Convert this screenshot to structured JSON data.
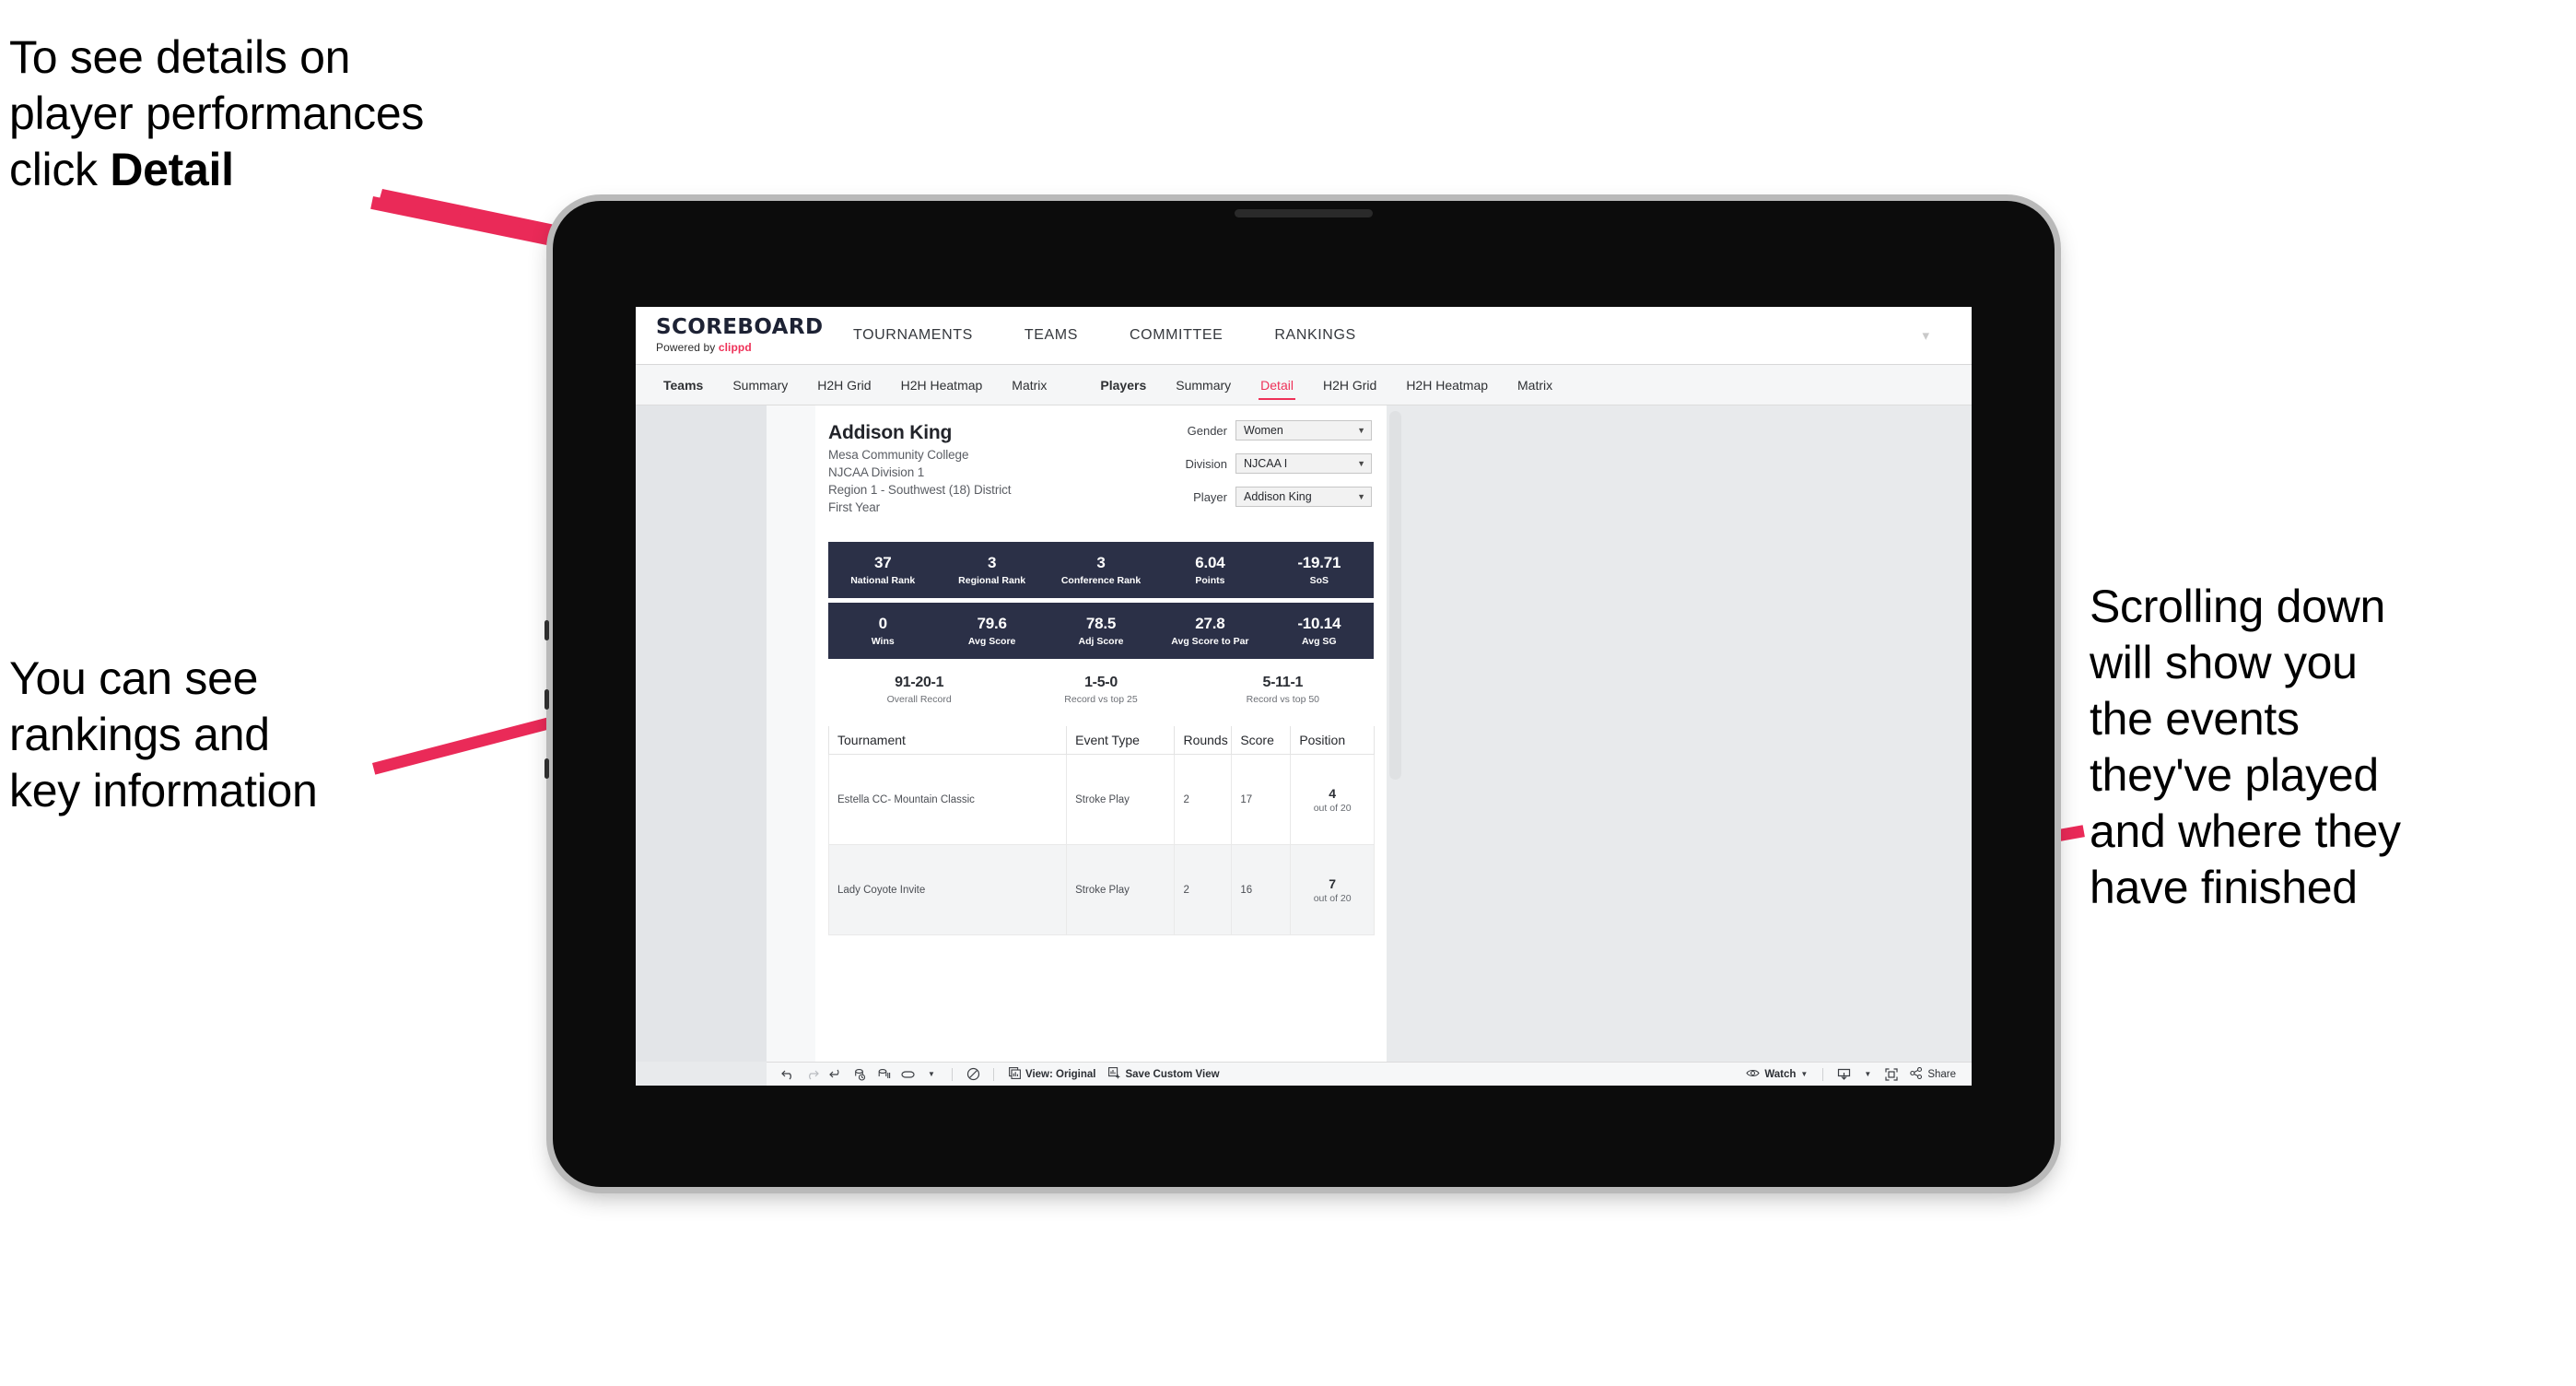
{
  "annotations": {
    "top_left": "To see details on\nplayer performances\nclick ",
    "top_left_bold": "Detail",
    "mid_left": "You can see\nrankings and\nkey information",
    "right": "Scrolling down\nwill show you\nthe events\nthey've played\nand where they\nhave finished",
    "arrow_color": "#ea2a58"
  },
  "browser": {
    "brand": {
      "title": "SCOREBOARD",
      "powered_prefix": "Powered by ",
      "powered_brand": "clippd"
    },
    "site_nav": [
      "TOURNAMENTS",
      "TEAMS",
      "COMMITTEE",
      "RANKINGS"
    ],
    "subnav_teams": [
      {
        "label": "Teams",
        "strong": true,
        "active": false
      },
      {
        "label": "Summary",
        "strong": false,
        "active": false
      },
      {
        "label": "H2H Grid",
        "strong": false,
        "active": false
      },
      {
        "label": "H2H Heatmap",
        "strong": false,
        "active": false
      },
      {
        "label": "Matrix",
        "strong": false,
        "active": false
      }
    ],
    "subnav_players": [
      {
        "label": "Players",
        "strong": true,
        "active": false
      },
      {
        "label": "Summary",
        "strong": false,
        "active": false
      },
      {
        "label": "Detail",
        "strong": false,
        "active": true
      },
      {
        "label": "H2H Grid",
        "strong": false,
        "active": false
      },
      {
        "label": "H2H Heatmap",
        "strong": false,
        "active": false
      },
      {
        "label": "Matrix",
        "strong": false,
        "active": false
      }
    ],
    "accent": "#ee3158"
  },
  "player": {
    "name": "Addison King",
    "school": "Mesa Community College",
    "division": "NJCAA Division 1",
    "region": "Region 1 - Southwest (18) District",
    "year": "First Year"
  },
  "selectors": [
    {
      "label": "Gender",
      "value": "Women"
    },
    {
      "label": "Division",
      "value": "NJCAA I"
    },
    {
      "label": "Player",
      "value": "Addison King"
    }
  ],
  "stats_row_1": [
    {
      "value": "37",
      "label": "National Rank"
    },
    {
      "value": "3",
      "label": "Regional Rank"
    },
    {
      "value": "3",
      "label": "Conference Rank"
    },
    {
      "value": "6.04",
      "label": "Points"
    },
    {
      "value": "-19.71",
      "label": "SoS"
    }
  ],
  "stats_row_2": [
    {
      "value": "0",
      "label": "Wins"
    },
    {
      "value": "79.6",
      "label": "Avg Score"
    },
    {
      "value": "78.5",
      "label": "Adj Score"
    },
    {
      "value": "27.8",
      "label": "Avg Score to Par"
    },
    {
      "value": "-10.14",
      "label": "Avg SG"
    }
  ],
  "records": [
    {
      "value": "91-20-1",
      "label": "Overall Record"
    },
    {
      "value": "1-5-0",
      "label": "Record vs top 25"
    },
    {
      "value": "5-11-1",
      "label": "Record vs top 50"
    }
  ],
  "table": {
    "headers": [
      "Tournament",
      "Event Type",
      "Rounds",
      "Score",
      "Position"
    ],
    "rows": [
      {
        "tournament": "Estella CC- Mountain Classic",
        "event_type": "Stroke Play",
        "rounds": "2",
        "score": "17",
        "position": "4",
        "position_of": "out of 20"
      },
      {
        "tournament": "Lady Coyote Invite",
        "event_type": "Stroke Play",
        "rounds": "2",
        "score": "16",
        "position": "7",
        "position_of": "out of 20"
      }
    ]
  },
  "toolbar": {
    "view_label": "View: Original",
    "save_label": "Save Custom View",
    "watch_label": "Watch",
    "share_label": "Share"
  }
}
